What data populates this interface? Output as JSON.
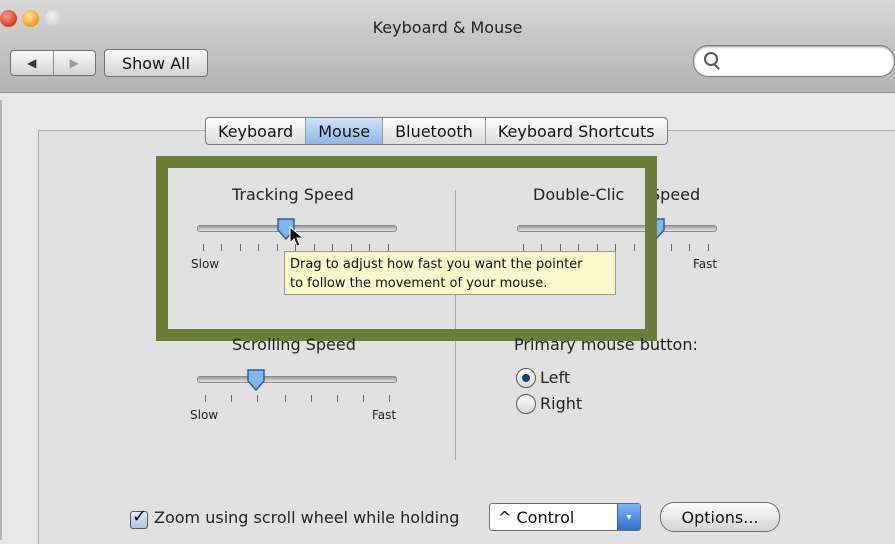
{
  "window": {
    "title": "Keyboard & Mouse"
  },
  "toolbar": {
    "back_glyph": "◀",
    "forward_glyph": "▶",
    "show_all_label": "Show All",
    "search_placeholder": ""
  },
  "tabs": [
    {
      "label": "Keyboard",
      "active": false
    },
    {
      "label": "Mouse",
      "active": true
    },
    {
      "label": "Bluetooth",
      "active": false
    },
    {
      "label": "Keyboard Shortcuts",
      "active": false
    }
  ],
  "tracking": {
    "label": "Tracking Speed",
    "min_label": "Slow",
    "value": 0.45
  },
  "double_click": {
    "label_left": "Double-Clic",
    "label_right": "Speed",
    "max_label": "Fast",
    "value": 0.7
  },
  "scrolling": {
    "label": "Scrolling Speed",
    "min_label": "Slow",
    "max_label": "Fast",
    "value": 0.3
  },
  "tooltip": {
    "line1": "Drag to adjust how fast you want the pointer",
    "line2": "to follow the movement of your mouse."
  },
  "primary_button": {
    "label": "Primary mouse button:",
    "options": [
      "Left",
      "Right"
    ],
    "selected": "Left"
  },
  "zoom": {
    "checkbox_label": "Zoom using scroll wheel while holding",
    "checked": true,
    "modifier_value": "^ Control",
    "options_label": "Options..."
  },
  "colors": {
    "highlight_border": "#6e7c3a",
    "tooltip_bg": "#fbf7cc",
    "tab_active": "#8fb6e6"
  }
}
